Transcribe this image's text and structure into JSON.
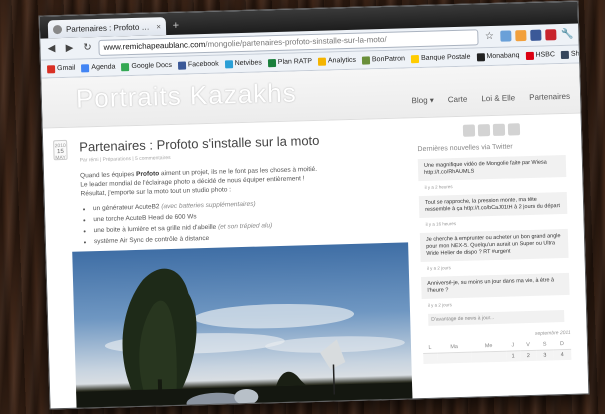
{
  "browser": {
    "tab_title": "Partenaires : Profoto s'installe",
    "url_host": "www.remichapeaublanc.com",
    "url_path": "/mongolie/partenaires-profoto-sinstalle-sur-la-moto/",
    "bookmarks": [
      "Gmail",
      "Agenda",
      "Google Docs",
      "Facebook",
      "Netvibes",
      "Plan RATP",
      "Analytics",
      "BonPatron",
      "Banque Postale",
      "Monabanq",
      "HSBC",
      "Share on Tumblr"
    ],
    "bookmark_colors": [
      "#d93025",
      "#4285f4",
      "#34a853",
      "#3b5998",
      "#2a9fd6",
      "#1a7f3c",
      "#f4b400",
      "#6a8f3a",
      "#ffcc00",
      "#222222",
      "#db0011",
      "#35465c"
    ]
  },
  "site": {
    "title": "Portraits Kazakhs",
    "nav": [
      "Blog",
      "Carte",
      "Loi & Elle",
      "Partenaires"
    ]
  },
  "post": {
    "date_month": "2010",
    "date_day": "15",
    "date_label": "MAY",
    "title": "Partenaires : Profoto s'installe sur la moto",
    "meta": "Par rémi | Préparations | 5 commentaires",
    "intro_1a": "Quand les équipes ",
    "intro_1b": "Profoto",
    "intro_1c": " aiment un projet, ils ne le font pas les choses à moitié.",
    "intro_2": "Le leader mondial de l'éclairage photo a décidé de nous équiper entièrement !",
    "intro_3": "Résultat, j'emporte sur la moto tout un studio photo :",
    "items": [
      {
        "text": "un générateur AcuteB2 ",
        "note": "(avec batteries supplémentaires)"
      },
      {
        "text": "une torche AcuteB Head de 600 Ws",
        "note": ""
      },
      {
        "text": "une boite à lumière et sa grille nid d'abeille ",
        "note": "(et son trépied alu)"
      },
      {
        "text": "système Air Sync de contrôle à distance",
        "note": ""
      }
    ]
  },
  "sidebar": {
    "twitter_title": "Dernières nouvelles via Twitter",
    "tweets": [
      {
        "text": "Une magnifique vidéo de Mongolie faite par Wiesa http://t.co/RhAUMLS",
        "time": "il y a 2 heures"
      },
      {
        "text": "Tout se rapproche, la pression monte, ma tête ressemble à ça http://t.co/bCaJ01tH à 2 jours du départ",
        "time": "il y a 16 heures"
      },
      {
        "text": "Je cherche à emprunter ou acheter un bon grand angle pour mon NEX-5. Quelqu'un aurait un Super ou Ultra Wide Helier de dispo ? RT #urgent",
        "time": "il y a 2 jours"
      },
      {
        "text": "Anniversé-je, su moins un jour dans ma vie, à être à l'heure ?",
        "time": "il y a 2 jours"
      }
    ],
    "more": "D'avantage de news à jour...",
    "cal_title": "septembre 2011",
    "cal_headers": [
      "L",
      "Ma",
      "Me",
      "J",
      "V",
      "S",
      "D"
    ],
    "cal_row": [
      "",
      "",
      "",
      "1",
      "2",
      "3",
      "4"
    ]
  },
  "colors": {
    "accent": "#3b5998"
  }
}
